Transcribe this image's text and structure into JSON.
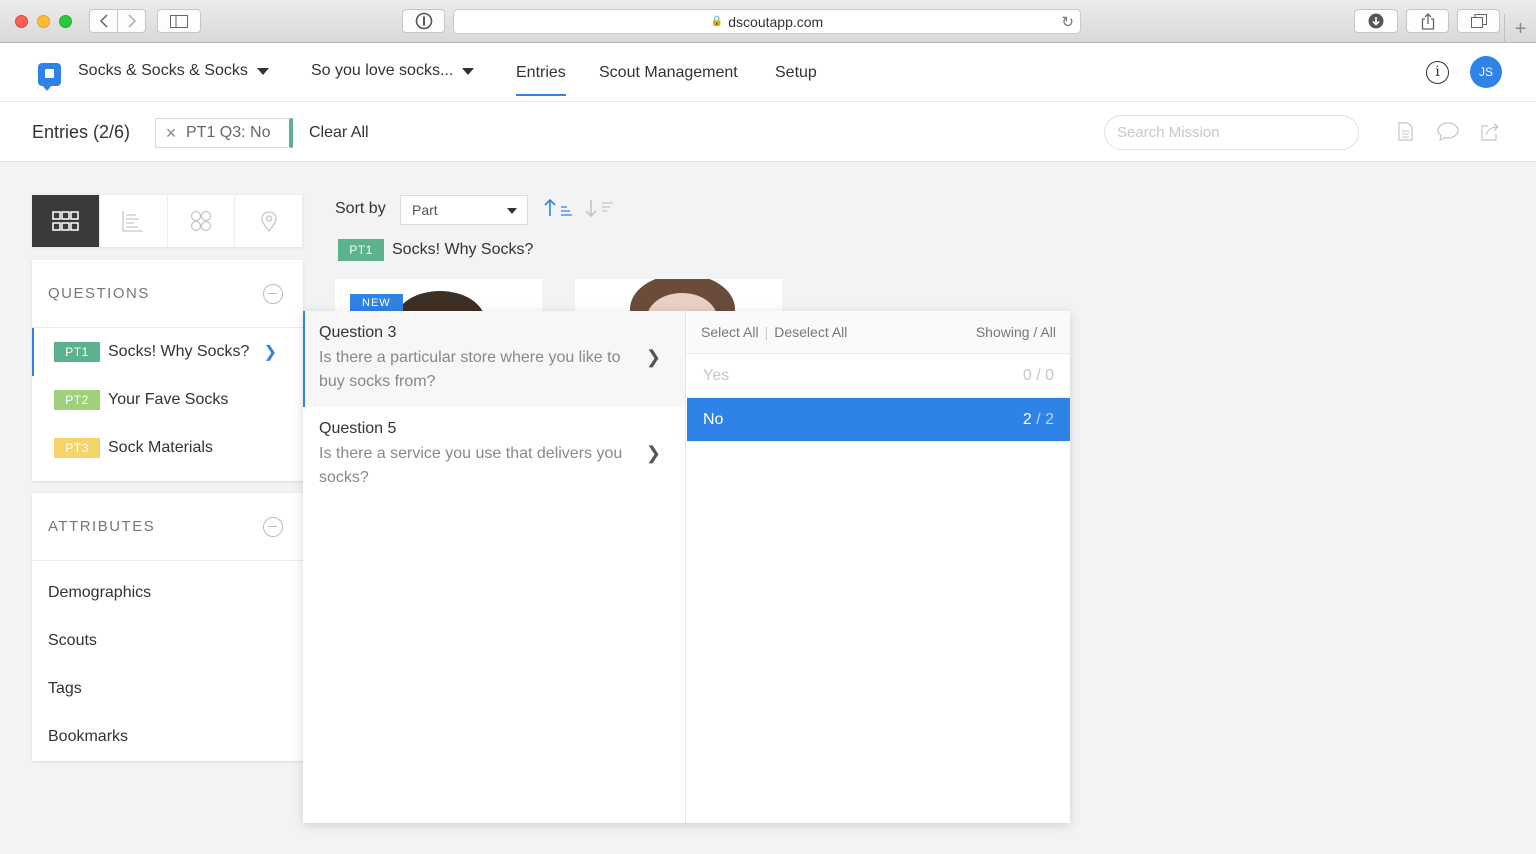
{
  "browser": {
    "url": "dscoutapp.com"
  },
  "header": {
    "project": "Socks & Socks & Socks",
    "mission": "So you love socks...",
    "tabs": [
      "Entries",
      "Scout Management",
      "Setup"
    ],
    "avatar_initials": "JS"
  },
  "subheader": {
    "title": "Entries (2/6)",
    "filter_chip": "PT1 Q3: No",
    "clear_all": "Clear All",
    "search_placeholder": "Search Mission"
  },
  "questions": {
    "heading": "QUESTIONS",
    "items": [
      {
        "badge": "PT1",
        "label": "Socks! Why Socks?",
        "color": "#5bb28c",
        "active": true
      },
      {
        "badge": "PT2",
        "label": "Your Fave Socks",
        "color": "#9fd07a",
        "active": false
      },
      {
        "badge": "PT3",
        "label": "Sock Materials",
        "color": "#f5d56a",
        "active": false
      }
    ]
  },
  "attributes": {
    "heading": "ATTRIBUTES",
    "items": [
      "Demographics",
      "Scouts",
      "Tags",
      "Bookmarks"
    ]
  },
  "sort": {
    "label": "Sort by",
    "value": "Part"
  },
  "section": {
    "badge": "PT1",
    "title": "Socks! Why Socks?"
  },
  "entry_badge": "NEW",
  "dropdown": {
    "questions": [
      {
        "title": "Question 3",
        "desc": "Is there a particular store where you like to buy socks from?"
      },
      {
        "title": "Question 5",
        "desc": "Is there a service you use that delivers you socks?"
      }
    ],
    "select_all": "Select All",
    "deselect_all": "Deselect All",
    "showing": "Showing / All",
    "options": [
      {
        "label": "Yes",
        "shown": "0",
        "total": "0",
        "state": "disabled"
      },
      {
        "label": "No",
        "shown": "2",
        "total": "2",
        "state": "selected"
      }
    ]
  }
}
